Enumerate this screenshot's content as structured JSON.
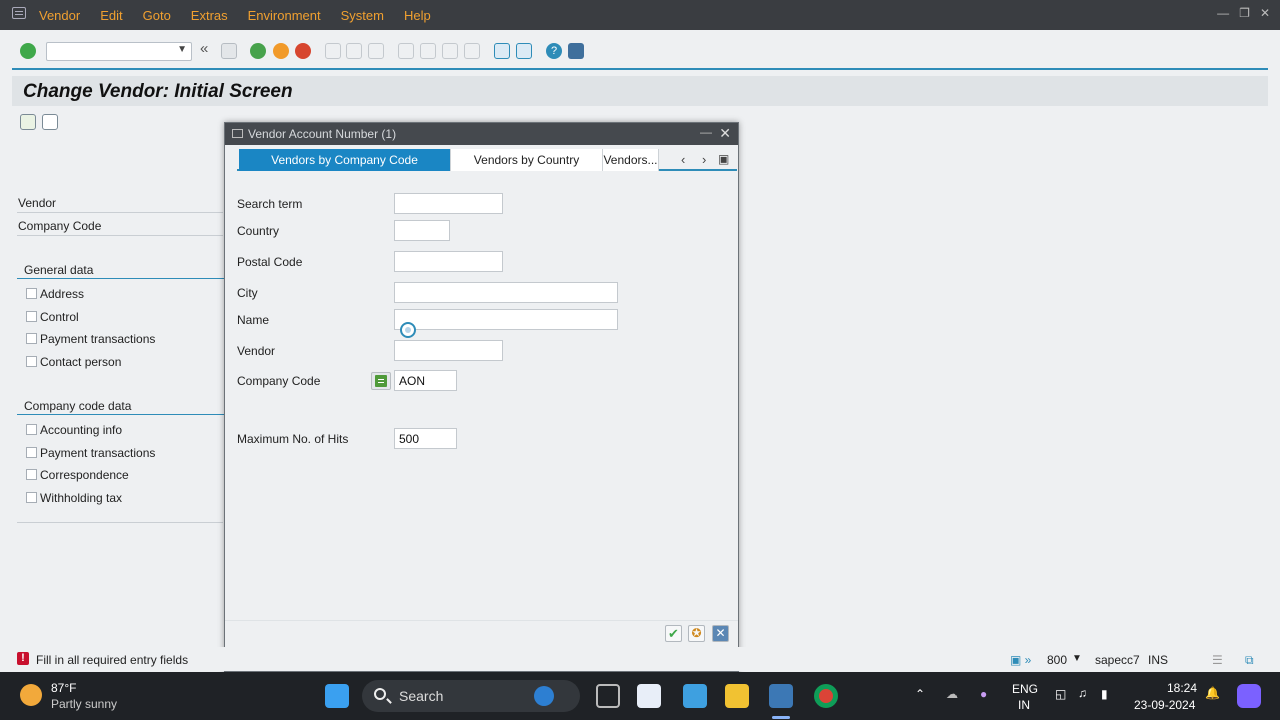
{
  "menu": {
    "items": [
      "Vendor",
      "Edit",
      "Goto",
      "Extras",
      "Environment",
      "System",
      "Help"
    ]
  },
  "toolbar": {
    "command_field_value": "",
    "icons": [
      "enter-icon",
      "back-nav-icon",
      "save-icon",
      "back-icon",
      "exit-icon",
      "cancel-icon",
      "print-icon",
      "find-icon",
      "find-next-icon",
      "first-page-icon",
      "previous-page-icon",
      "next-page-icon",
      "last-page-icon",
      "create-session-icon",
      "shortcut-icon",
      "help-icon",
      "customize-layout-icon"
    ]
  },
  "page": {
    "title": "Change Vendor:  Initial Screen",
    "fields": {
      "vendor_label": "Vendor",
      "company_code_label": "Company Code"
    },
    "general_data": {
      "title": "General data",
      "items": [
        "Address",
        "Control",
        "Payment transactions",
        "Contact person"
      ]
    },
    "company_code_data": {
      "title": "Company code data",
      "items": [
        "Accounting info",
        "Payment transactions",
        "Correspondence",
        "Withholding tax"
      ]
    }
  },
  "dialog": {
    "title": "Vendor Account Number (1)",
    "tabs": [
      "Vendors by Company Code",
      "Vendors by Country",
      "Vendors..."
    ],
    "active_tab": "Vendors by Company Code",
    "fields": {
      "search_term": {
        "label": "Search term",
        "value": ""
      },
      "country": {
        "label": "Country",
        "value": ""
      },
      "postal_code": {
        "label": "Postal Code",
        "value": ""
      },
      "city": {
        "label": "City",
        "value": ""
      },
      "name": {
        "label": "Name",
        "value": ""
      },
      "vendor": {
        "label": "Vendor",
        "value": ""
      },
      "company_code": {
        "label": "Company Code",
        "value": "AON"
      },
      "max_hits": {
        "label": "Maximum No. of Hits",
        "value": "500"
      }
    }
  },
  "status": {
    "message": "Fill in all required entry fields",
    "client": "800",
    "server": "sapecc7",
    "mode": "INS"
  },
  "taskbar": {
    "weather_temp": "87°F",
    "weather_desc": "Partly sunny",
    "search_label": "Search",
    "lang_top": "ENG",
    "lang_bottom": "IN",
    "time": "18:24",
    "date": "23-09-2024"
  }
}
